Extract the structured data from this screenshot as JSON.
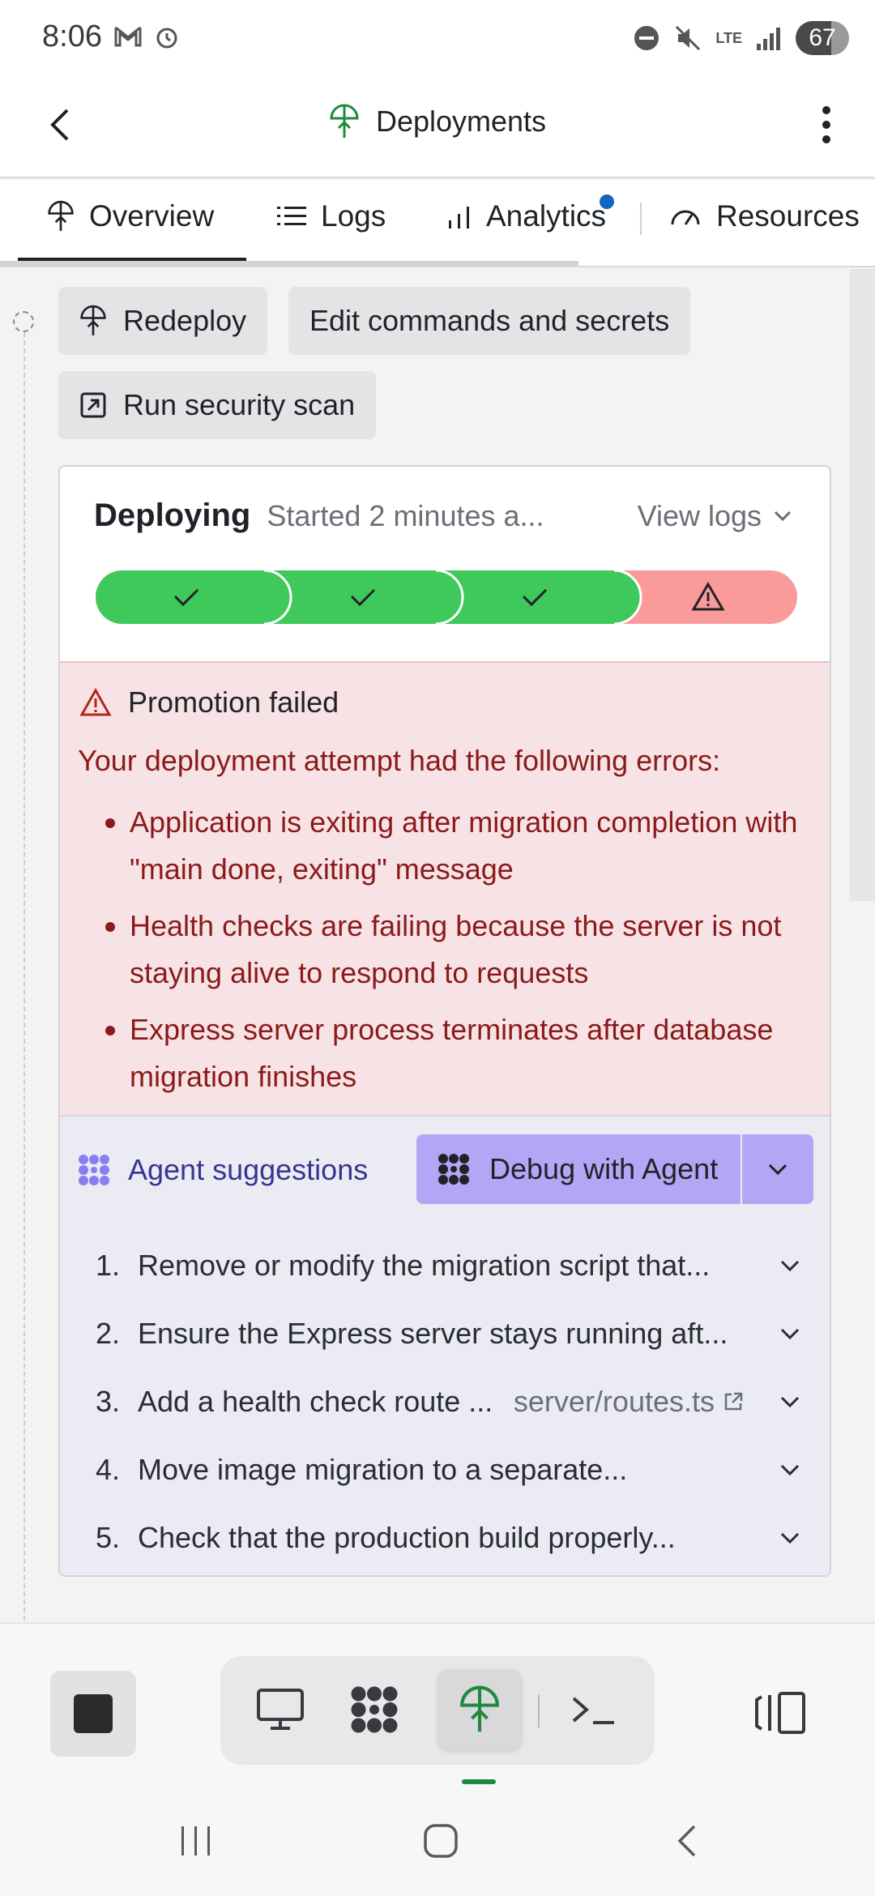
{
  "status_bar": {
    "time": "8:06",
    "battery": "67",
    "network": "LTE"
  },
  "header": {
    "title": "Deployments",
    "back_icon": "chevron-left-icon",
    "more_icon": "more-vertical-icon",
    "accent_color": "#1e8a3e"
  },
  "tabs": [
    {
      "label": "Overview",
      "icon": "deploy-icon",
      "active": true
    },
    {
      "label": "Logs",
      "icon": "list-icon"
    },
    {
      "label": "Analytics",
      "icon": "bar-chart-icon",
      "has_notification": true
    },
    {
      "label": "Resources",
      "icon": "gauge-icon"
    }
  ],
  "actions": {
    "redeploy": "Redeploy",
    "edit": "Edit commands and secrets",
    "scan": "Run security scan"
  },
  "deployment": {
    "status": "Deploying",
    "started": "Started 2 minutes a...",
    "view_logs": "View logs",
    "steps": [
      {
        "state": "done",
        "color": "#3ec95a"
      },
      {
        "state": "done",
        "color": "#3ec95a"
      },
      {
        "state": "done",
        "color": "#3ec95a"
      },
      {
        "state": "warning",
        "color": "#fb9a9a"
      }
    ]
  },
  "error": {
    "title": "Promotion failed",
    "intro": "Your deployment attempt had the following errors:",
    "items": [
      "Application is exiting after migration completion with \"main done, exiting\" message",
      "Health checks are failing because the server is not staying alive to respond to requests",
      "Express server process terminates after database migration finishes"
    ],
    "color": "#8b1a1a"
  },
  "agent": {
    "label": "Agent suggestions",
    "debug_button": "Debug with Agent",
    "suggestions": [
      {
        "num": "1.",
        "text": "Remove or modify the migration script that..."
      },
      {
        "num": "2.",
        "text": "Ensure the Express server stays running aft..."
      },
      {
        "num": "3.",
        "text": "Add a health check route ...",
        "file": "server/routes.ts"
      },
      {
        "num": "4.",
        "text": "Move image migration to a separate..."
      },
      {
        "num": "5.",
        "text": "Check that the production build properly..."
      }
    ]
  },
  "toolbar": {
    "active_tool": "deployments"
  }
}
